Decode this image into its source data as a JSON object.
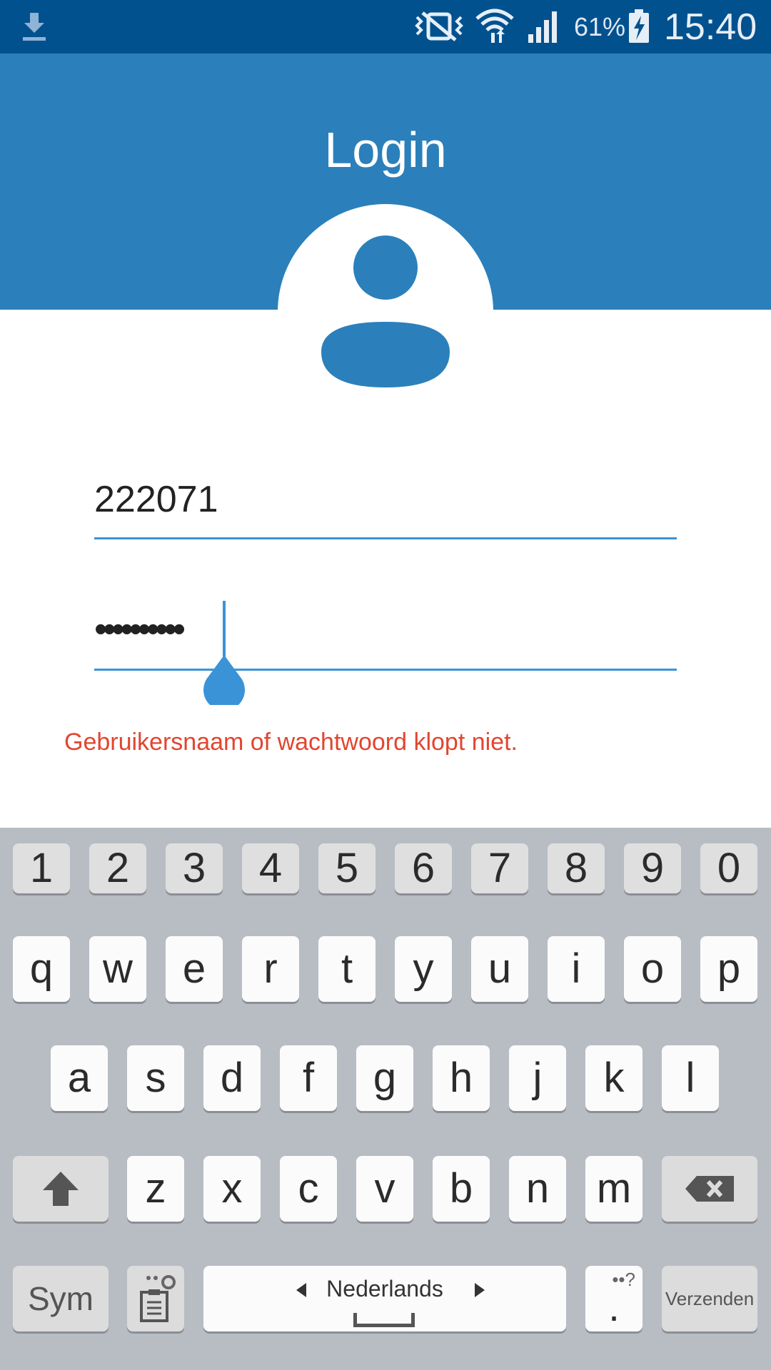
{
  "status_bar": {
    "battery_percent": "61%",
    "time": "15:40",
    "icons": [
      "download-icon",
      "vibrate-icon",
      "wifi-icon",
      "signal-icon",
      "battery-charging-icon"
    ]
  },
  "header": {
    "title": "Login",
    "avatar_icon": "person-icon",
    "background_color": "#2b80bb"
  },
  "form": {
    "username_value": "222071",
    "password_value": "••••••••••",
    "accent_color": "#3b93d7"
  },
  "error_message": "Gebruikersnaam of wachtwoord klopt niet.",
  "error_color": "#e2452f",
  "keyboard": {
    "number_row": [
      "1",
      "2",
      "3",
      "4",
      "5",
      "6",
      "7",
      "8",
      "9",
      "0"
    ],
    "row1": [
      "q",
      "w",
      "e",
      "r",
      "t",
      "y",
      "u",
      "i",
      "o",
      "p"
    ],
    "row2": [
      "a",
      "s",
      "d",
      "f",
      "g",
      "h",
      "j",
      "k",
      "l"
    ],
    "row3": [
      "z",
      "x",
      "c",
      "v",
      "b",
      "n",
      "m"
    ],
    "sym_label": "Sym",
    "language_label": "Nederlands",
    "period_label": ".",
    "send_label": "Verzenden",
    "icons": [
      "shift-icon",
      "backspace-icon",
      "clipboard-settings-icon",
      "space-icon"
    ]
  }
}
